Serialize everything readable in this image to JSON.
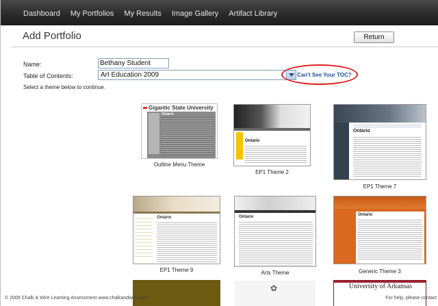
{
  "nav": {
    "items": [
      "Dashboard",
      "My Portfolios",
      "My Results",
      "Image Gallery",
      "Artifact Library"
    ]
  },
  "header": {
    "title": "Add Portfolio",
    "return_label": "Return"
  },
  "form": {
    "name_label": "Name:",
    "name_value": "Bethany Student",
    "toc_label": "Table of Contents:",
    "toc_value": "Art Education 2009",
    "toc_link": "Can't See Your TOC?",
    "instruction": "Select a theme below to continue."
  },
  "themes": [
    {
      "label": "Outline Menu Theme",
      "preview_heading": "Gigantic State University",
      "preview_sub": "Ontario"
    },
    {
      "label": "EP1 Theme 2",
      "preview_heading": "Ontario"
    },
    {
      "label": "EP1 Theme 7",
      "preview_heading": "Ontario"
    },
    {
      "label": "EP1 Theme 9",
      "preview_heading": "Ontario"
    },
    {
      "label": "Arts Theme",
      "preview_heading": "Ontario"
    },
    {
      "label": "Generic Theme 3",
      "preview_heading": "Ontario"
    },
    {
      "label": "",
      "preview_heading": "University of Arkansas"
    }
  ],
  "footer": {
    "left": "© 2009 Chalk & Wire Learning Assessment   www.chalkandwire.com",
    "right": "For help, please contact"
  },
  "colors": {
    "nav_bg": "#2a2a2a",
    "link": "#1f4d9a",
    "highlight_circle": "#e02020",
    "theme7_sidebar": "#34414f",
    "generic3_orange": "#d9691e",
    "ep1_theme2_yellow": "#f5c400"
  }
}
